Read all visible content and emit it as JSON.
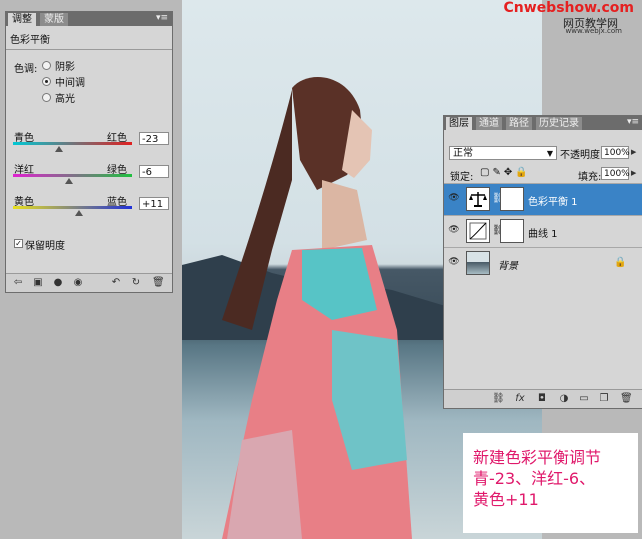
{
  "watermark": {
    "brand": "Cnwebshow.com",
    "sub": "网页教学网",
    "url": "www.webjx.com"
  },
  "adjustments": {
    "tabs": [
      "调整",
      "蒙版"
    ],
    "title": "色彩平衡",
    "tone_label": "色调:",
    "tones": [
      {
        "label": "阴影",
        "selected": false
      },
      {
        "label": "中间调",
        "selected": true
      },
      {
        "label": "高光",
        "selected": false
      }
    ],
    "sliders": [
      {
        "left": "青色",
        "right": "红色",
        "value": "-23",
        "level": -23
      },
      {
        "left": "洋红",
        "right": "绿色",
        "value": "-6",
        "level": -6
      },
      {
        "left": "黄色",
        "right": "蓝色",
        "value": "+11",
        "level": 11
      }
    ],
    "preserve_label": "保留明度",
    "preserve_checked": true,
    "bottom_icons": [
      "back-arrow-icon",
      "fit-icon",
      "clip-icon",
      "eye-icon",
      "reset-icon",
      "refresh-icon",
      "trash-icon"
    ]
  },
  "layers": {
    "tabs": [
      "图层",
      "通道",
      "路径",
      "历史记录"
    ],
    "blend_mode": "正常",
    "opacity_label": "不透明度:",
    "opacity": "100%",
    "lock_label": "锁定:",
    "fill_label": "填充:",
    "fill": "100%",
    "items": [
      {
        "name": "色彩平衡 1",
        "selected": true
      },
      {
        "name": "曲线 1",
        "selected": false
      },
      {
        "name": "背景",
        "selected": false
      }
    ]
  },
  "caption": [
    "新建色彩平衡调节",
    "青-23、洋红-6、",
    "黄色+11"
  ],
  "colors": {
    "selection": "#3a83c6",
    "caption_text": "#e0196b",
    "brand": "#e52020"
  }
}
